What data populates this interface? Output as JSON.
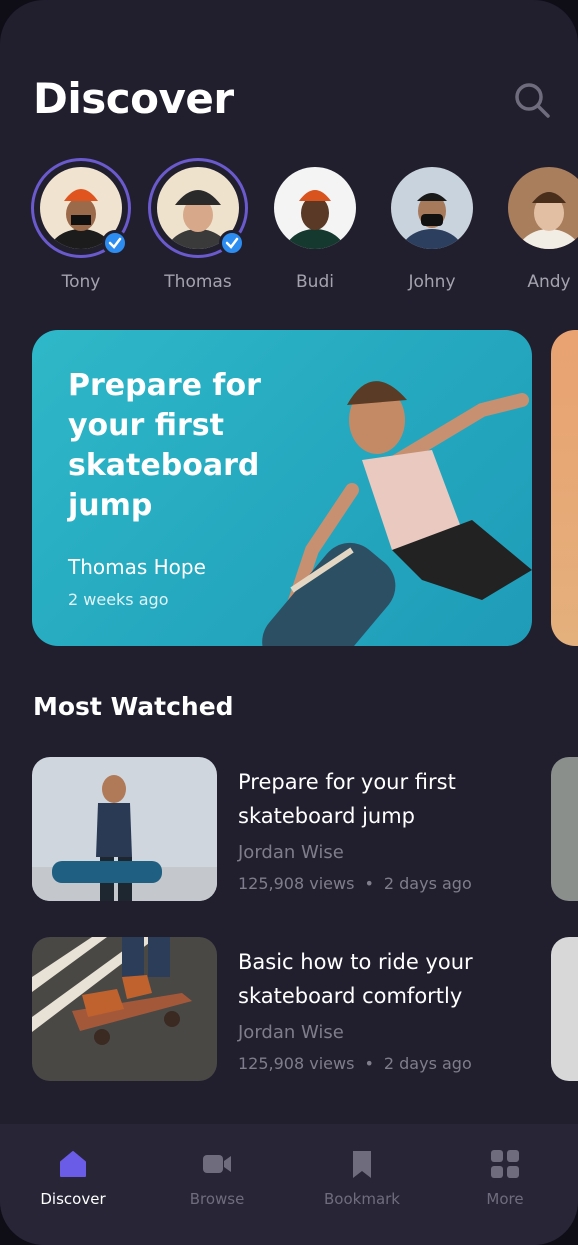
{
  "header": {
    "title": "Discover",
    "search_icon": "search-icon"
  },
  "stories": [
    {
      "name": "Tony",
      "verified": true,
      "highlighted": true
    },
    {
      "name": "Thomas",
      "verified": true,
      "highlighted": true
    },
    {
      "name": "Budi",
      "verified": false,
      "highlighted": false
    },
    {
      "name": "Johny",
      "verified": false,
      "highlighted": false
    },
    {
      "name": "Andy",
      "verified": false,
      "highlighted": false
    }
  ],
  "featured": {
    "title": "Prepare for your first skateboard jump",
    "author": "Thomas Hope",
    "time": "2 weeks ago"
  },
  "most_watched": {
    "title": "Most Watched",
    "videos": [
      {
        "title": "Prepare for your first skateboard jump",
        "author": "Jordan Wise",
        "views": "125,908 views",
        "dot": "•",
        "time": "2 days ago"
      },
      {
        "title": "Basic how to ride your skateboard comfortly",
        "author": "Jordan Wise",
        "views": "125,908 views",
        "dot": "•",
        "time": "2 days ago"
      }
    ]
  },
  "navbar": {
    "items": [
      {
        "label": "Discover",
        "icon": "home-icon",
        "active": true
      },
      {
        "label": "Browse",
        "icon": "video-camera-icon",
        "active": false
      },
      {
        "label": "Bookmark",
        "icon": "bookmark-icon",
        "active": false
      },
      {
        "label": "More",
        "icon": "grid-icon",
        "active": false
      }
    ]
  },
  "colors": {
    "background": "#211f2e",
    "accent": "#6a5acd",
    "verified": "#2d8cf0",
    "featured_card": "#2fb8c8",
    "muted_text": "#7f7d8c"
  }
}
